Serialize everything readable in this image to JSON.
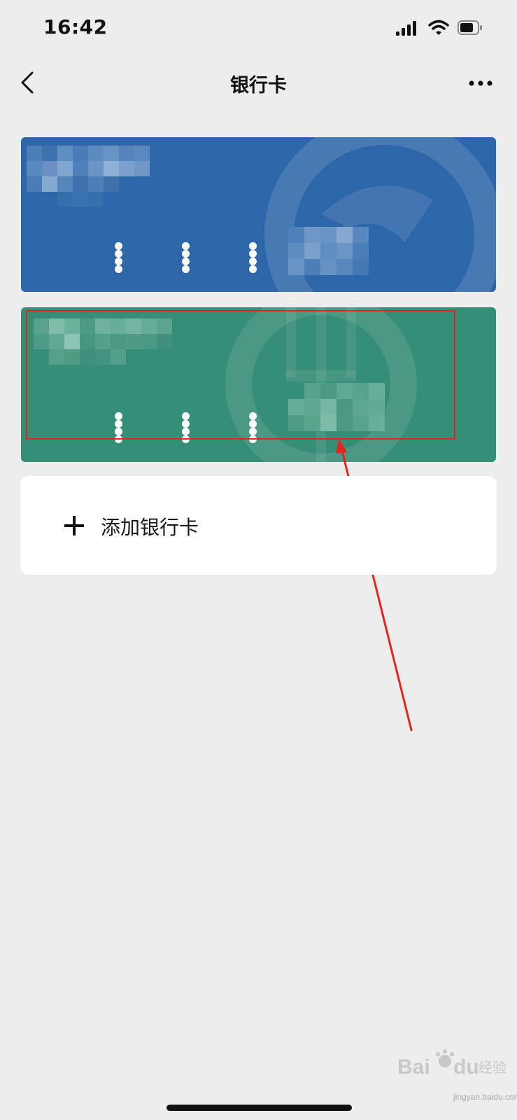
{
  "status_bar": {
    "time": "16:42",
    "icons": [
      "cellular-signal-icon",
      "wifi-icon",
      "battery-icon"
    ]
  },
  "nav": {
    "title": "银行卡",
    "back_icon": "chevron-left-icon",
    "more_icon": "more-dots-icon"
  },
  "cards": [
    {
      "bank_name": "blurred",
      "number_mask": [
        "••••",
        "••••",
        "••••"
      ],
      "last_digits": "blurred",
      "color": "#2e67a9"
    },
    {
      "bank_name": "blurred",
      "number_mask": [
        "••••",
        "••••",
        "••••"
      ],
      "last_digits": "blurred",
      "color": "#378e78"
    }
  ],
  "add_card": {
    "label": "添加银行卡",
    "icon": "plus-icon"
  },
  "annotation": {
    "highlight_color": "#e3261f"
  },
  "watermark": {
    "domain": "jingyan.baidu.com"
  }
}
